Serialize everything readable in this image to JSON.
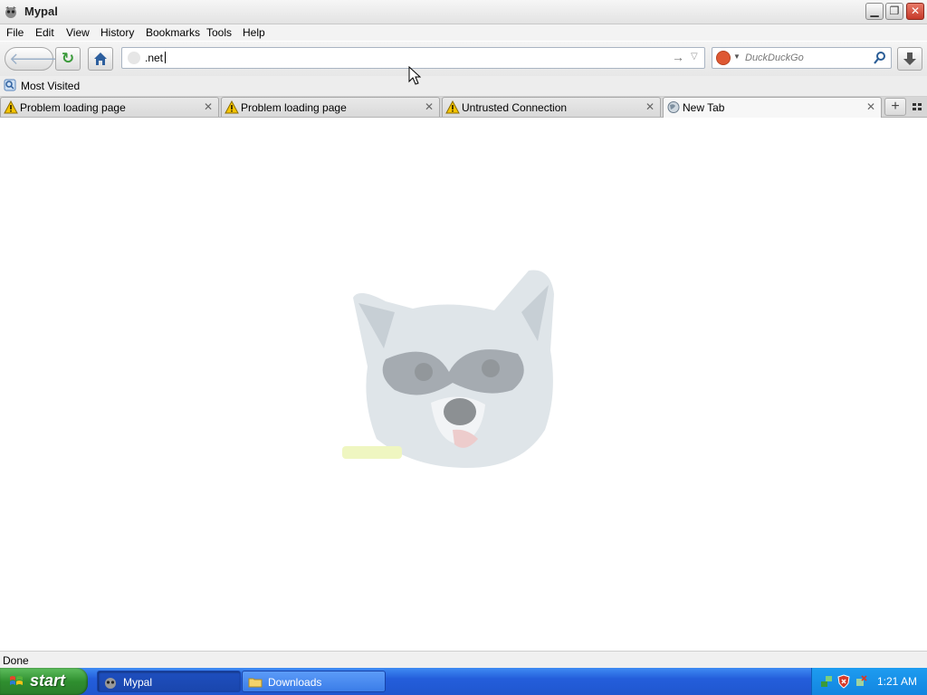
{
  "window": {
    "title": "Mypal"
  },
  "menu": [
    {
      "label": "File"
    },
    {
      "label": "Edit"
    },
    {
      "label": "View"
    },
    {
      "label": "History"
    },
    {
      "label": "Bookmarks"
    },
    {
      "label": "Tools"
    },
    {
      "label": "Help"
    }
  ],
  "navbar": {
    "url_value": ".net",
    "search_placeholder": "DuckDuckGo"
  },
  "bookmarks": {
    "items": [
      {
        "label": "Most Visited"
      }
    ]
  },
  "tabs": [
    {
      "label": "Problem loading page",
      "icon": "warning-icon",
      "active": false
    },
    {
      "label": "Problem loading page",
      "icon": "warning-icon",
      "active": false
    },
    {
      "label": "Untrusted Connection",
      "icon": "warning-icon",
      "active": false
    },
    {
      "label": "New Tab",
      "icon": "globe-icon",
      "active": true
    }
  ],
  "content": {
    "logo_icon": "raccoon-logo-icon"
  },
  "status": {
    "text": "Done"
  },
  "taskbar": {
    "start_label": "start",
    "tasks": [
      {
        "label": "Mypal",
        "active": true
      },
      {
        "label": "Downloads",
        "active": false
      }
    ],
    "clock": "1:21 AM"
  },
  "colors": {
    "taskbar_blue": "#245edb",
    "start_green": "#2f8f2f",
    "warning_yellow": "#f5c400"
  }
}
